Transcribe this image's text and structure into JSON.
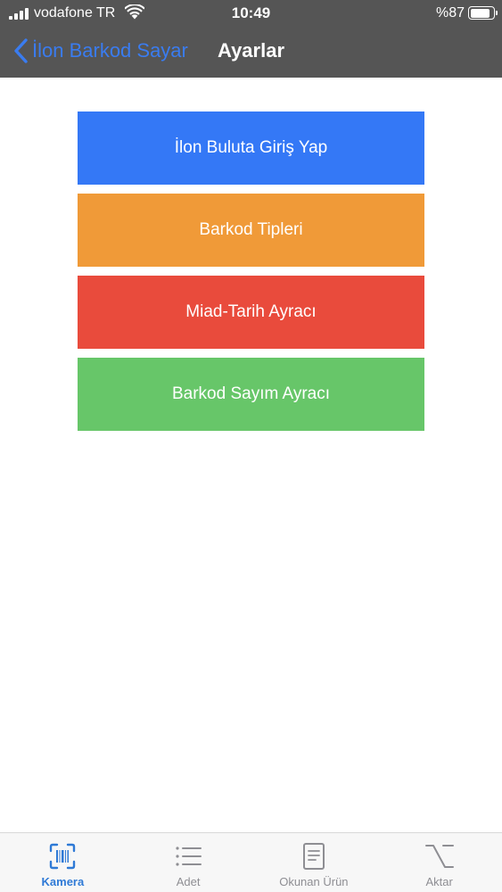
{
  "status_bar": {
    "carrier": "vodafone TR",
    "time": "10:49",
    "battery": "%87",
    "battery_level": 0.87
  },
  "nav": {
    "back_label": "İlon Barkod Sayar",
    "title": "Ayarlar"
  },
  "menu": [
    {
      "label": "İlon Buluta Giriş Yap",
      "color": "#3478f6"
    },
    {
      "label": "Barkod Tipleri",
      "color": "#f09a38"
    },
    {
      "label": "Miad-Tarih Ayracı",
      "color": "#e94b3c"
    },
    {
      "label": "Barkod Sayım Ayracı",
      "color": "#67c669"
    }
  ],
  "tabs": [
    {
      "label": "Kamera",
      "icon": "barcode-scan-icon",
      "active": true
    },
    {
      "label": "Adet",
      "icon": "list-icon",
      "active": false
    },
    {
      "label": "Okunan Ürün",
      "icon": "document-icon",
      "active": false
    },
    {
      "label": "Aktar",
      "icon": "option-key-icon",
      "active": false
    }
  ],
  "colors": {
    "header_bg": "#555555",
    "accent": "#3a7cf0",
    "tab_active": "#2f7ad6",
    "tab_inactive": "#8e8e93"
  }
}
